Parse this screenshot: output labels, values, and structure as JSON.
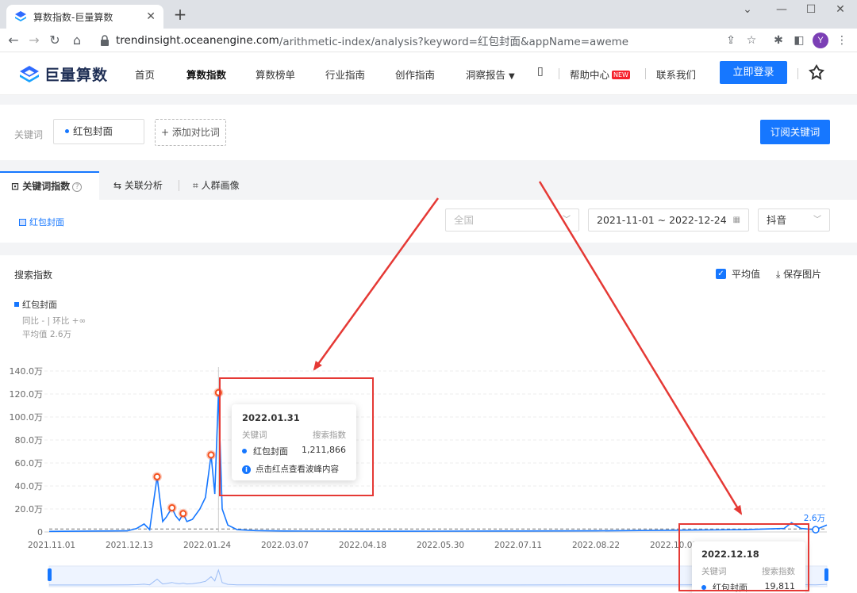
{
  "browser": {
    "tab_title": "算数指数-巨量算数",
    "url_host": "trendinsight.oceanengine.com",
    "url_path": "/arithmetic-index/analysis?keyword=红包封面&appName=aweme",
    "avatar_letter": "Y"
  },
  "header": {
    "logo_text": "巨量算数",
    "nav": [
      "首页",
      "算数指数",
      "算数榜单",
      "行业指南",
      "创作指南",
      "洞察报告"
    ],
    "help": "帮助中心",
    "new_badge": "NEW",
    "contact": "联系我们",
    "login": "立即登录"
  },
  "keyword_bar": {
    "label": "关键词",
    "keyword": "红包封面",
    "add_compare": "添加对比词",
    "subscribe": "订阅关键词"
  },
  "tabs": [
    "关键词指数",
    "关联分析",
    "人群画像"
  ],
  "filters": {
    "legend_tag": "红包封面",
    "region_placeholder": "全国",
    "date_range": "2021-11-01 ~ 2022-12-24",
    "platform": "抖音"
  },
  "chart_section": {
    "title": "搜索指数",
    "avg_label": "平均值",
    "save_label": "保存图片",
    "series_label": "红包封面",
    "yoy_mom": "同比 - | 环比 +∞",
    "avg_text": "平均值 2.6万",
    "avg_marker": "2.6万"
  },
  "tooltip_main": {
    "date": "2022.01.31",
    "col_keyword": "关键词",
    "col_index": "搜索指数",
    "keyword": "红包封面",
    "value": "1,211,866",
    "hint": "点击红点查看波峰内容"
  },
  "tooltip_end": {
    "date": "2022.12.18",
    "col_keyword": "关键词",
    "col_index": "搜索指数",
    "keyword": "红包封面",
    "value": "19,811"
  },
  "chart_data": {
    "type": "line",
    "x_ticks": [
      "2021.11.01",
      "2021.12.13",
      "2022.01.24",
      "2022.03.07",
      "2022.04.18",
      "2022.05.30",
      "2022.07.11",
      "2022.08.22",
      "2022.10.03"
    ],
    "y_ticks": [
      "0",
      "20.0万",
      "40.0万",
      "60.0万",
      "80.0万",
      "100.0万",
      "120.0万",
      "140.0万"
    ],
    "ylim": [
      0,
      1400000
    ],
    "xlim": [
      "2021-11-01",
      "2022-12-24"
    ],
    "average": 26000,
    "series": [
      {
        "name": "红包封面",
        "points": [
          [
            "2021-11-01",
            5000
          ],
          [
            "2021-11-15",
            6000
          ],
          [
            "2021-12-01",
            8000
          ],
          [
            "2021-12-13",
            10000
          ],
          [
            "2021-12-18",
            30000
          ],
          [
            "2021-12-22",
            70000
          ],
          [
            "2021-12-25",
            20000
          ],
          [
            "2021-12-29",
            480000
          ],
          [
            "2022-01-01",
            90000
          ],
          [
            "2022-01-03",
            130000
          ],
          [
            "2022-01-06",
            210000
          ],
          [
            "2022-01-08",
            140000
          ],
          [
            "2022-01-10",
            100000
          ],
          [
            "2022-01-12",
            160000
          ],
          [
            "2022-01-14",
            90000
          ],
          [
            "2022-01-17",
            110000
          ],
          [
            "2022-01-21",
            200000
          ],
          [
            "2022-01-24",
            300000
          ],
          [
            "2022-01-27",
            670000
          ],
          [
            "2022-01-29",
            330000
          ],
          [
            "2022-01-31",
            1211866
          ],
          [
            "2022-02-02",
            200000
          ],
          [
            "2022-02-05",
            60000
          ],
          [
            "2022-02-10",
            20000
          ],
          [
            "2022-02-20",
            12000
          ],
          [
            "2022-03-07",
            8000
          ],
          [
            "2022-04-18",
            6000
          ],
          [
            "2022-05-30",
            7000
          ],
          [
            "2022-07-11",
            8000
          ],
          [
            "2022-08-22",
            10000
          ],
          [
            "2022-10-03",
            15000
          ],
          [
            "2022-11-10",
            20000
          ],
          [
            "2022-12-01",
            30000
          ],
          [
            "2022-12-05",
            80000
          ],
          [
            "2022-12-10",
            30000
          ],
          [
            "2022-12-18",
            19811
          ],
          [
            "2022-12-24",
            60000
          ]
        ]
      }
    ],
    "peaks": [
      "2021-12-29",
      "2022-01-06",
      "2022-01-12",
      "2022-01-27",
      "2022-01-31"
    ],
    "line_color": "#1677ff",
    "peak_color": "#f4511e"
  },
  "colors": {
    "accent": "#1677ff",
    "annotation": "#e53935"
  }
}
